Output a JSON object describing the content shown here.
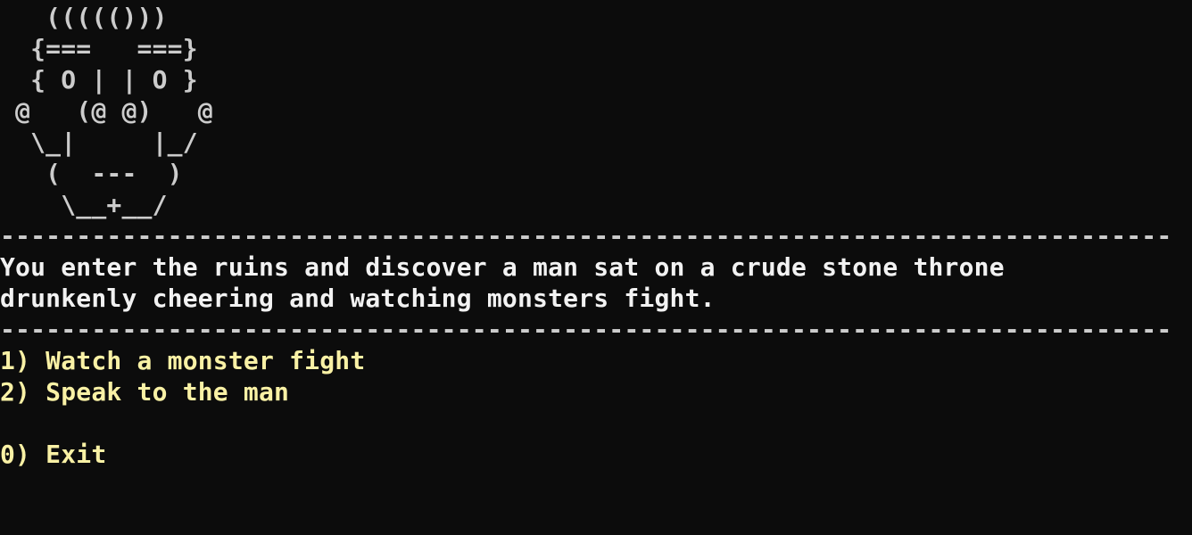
{
  "ascii_art": [
    "   ((((()))",
    "  {===   ===}",
    "  { O | | O }",
    " @   (@ @)   @",
    "  \\_|     |_/",
    "   (  ---  )",
    "    \\__+__/"
  ],
  "separator": "-----------------------------------------------------------------------------------",
  "story": {
    "line1": "You enter the ruins and discover a man sat on a crude stone throne",
    "line2": "drunkenly cheering and watching monsters fight."
  },
  "options": {
    "watch": "1) Watch a monster fight",
    "speak": "2) Speak to the man",
    "exit": "0) Exit"
  },
  "colors": {
    "background": "#0c0c0c",
    "text": "#f2f2f2",
    "menu": "#f9f1a5"
  }
}
